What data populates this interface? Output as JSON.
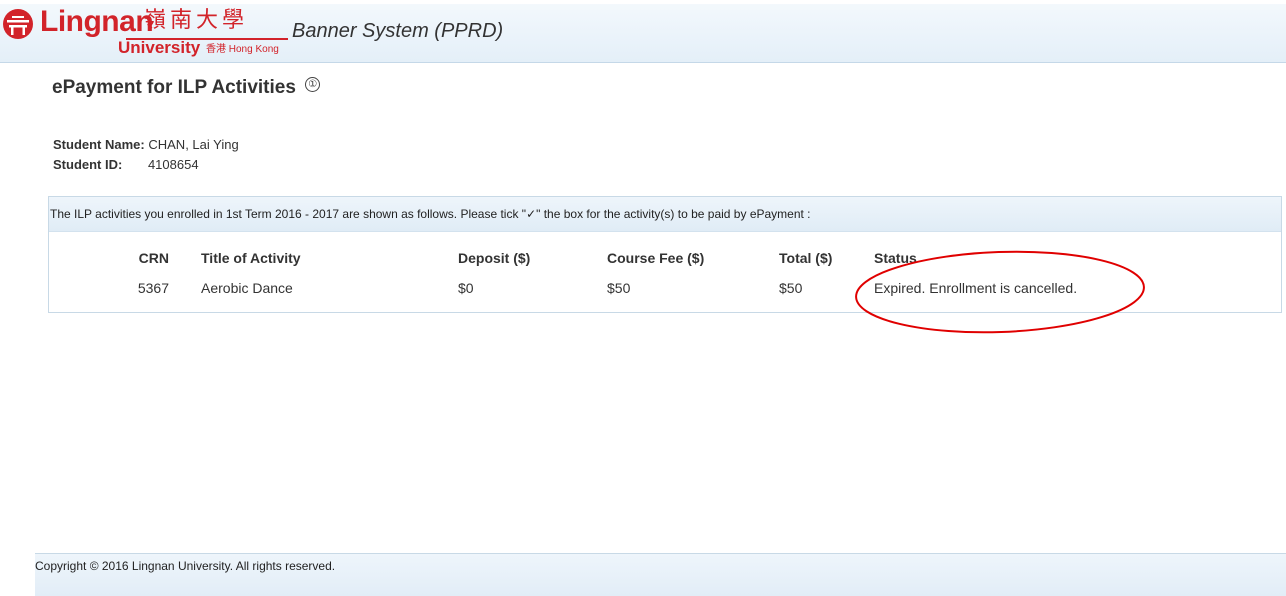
{
  "header": {
    "logo_name": "Lingnan",
    "logo_chinese": "嶺南大學",
    "logo_university": "University",
    "logo_hk": "香港 Hong Kong",
    "system_title": "Banner System (PPRD)"
  },
  "page": {
    "title": "ePayment for ILP Activities",
    "info_icon": "①"
  },
  "student": {
    "name_label": "Student Name:",
    "name_value": "CHAN, Lai Ying",
    "id_label": "Student ID:",
    "id_value": "4108654"
  },
  "activities": {
    "instruction": "The ILP activities you enrolled in 1st Term 2016 - 2017 are shown as follows. Please tick \"✓\" the box for the activity(s) to be paid by ePayment :",
    "columns": [
      "CRN",
      "Title of Activity",
      "Deposit ($)",
      "Course Fee ($)",
      "Total ($)",
      "Status"
    ],
    "rows": [
      {
        "crn": "5367",
        "title": "Aerobic Dance",
        "deposit": "$0",
        "course_fee": "$50",
        "total": "$50",
        "status": "Expired. Enrollment is cancelled."
      }
    ],
    "status_color": "#c8102e",
    "annotation_color": "#e00000"
  },
  "footer": {
    "copyright": "Copyright © 2016 Lingnan University. All rights reserved."
  }
}
